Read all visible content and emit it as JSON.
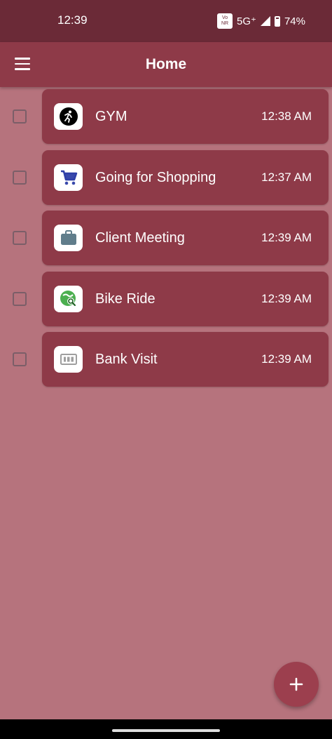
{
  "status_bar": {
    "time": "12:39",
    "network": "5G⁺",
    "battery": "74%",
    "volte_top": "Vo",
    "volte_bottom": "NR"
  },
  "app_bar": {
    "title": "Home"
  },
  "tasks": [
    {
      "title": "GYM",
      "time": "12:38 AM",
      "icon": "running-icon",
      "checked": false
    },
    {
      "title": "Going for Shopping",
      "time": "12:37 AM",
      "icon": "shopping-cart-icon",
      "checked": false
    },
    {
      "title": "Client Meeting",
      "time": "12:39 AM",
      "icon": "briefcase-icon",
      "checked": false
    },
    {
      "title": "Bike Ride",
      "time": "12:39 AM",
      "icon": "bike-ride-icon",
      "checked": false
    },
    {
      "title": "Bank Visit",
      "time": "12:39 AM",
      "icon": "bank-note-icon",
      "checked": false
    }
  ],
  "colors": {
    "background": "#b6737d",
    "card": "#8e3a48",
    "status_bar": "#6b2a37"
  },
  "fab": {
    "icon": "plus-icon"
  }
}
